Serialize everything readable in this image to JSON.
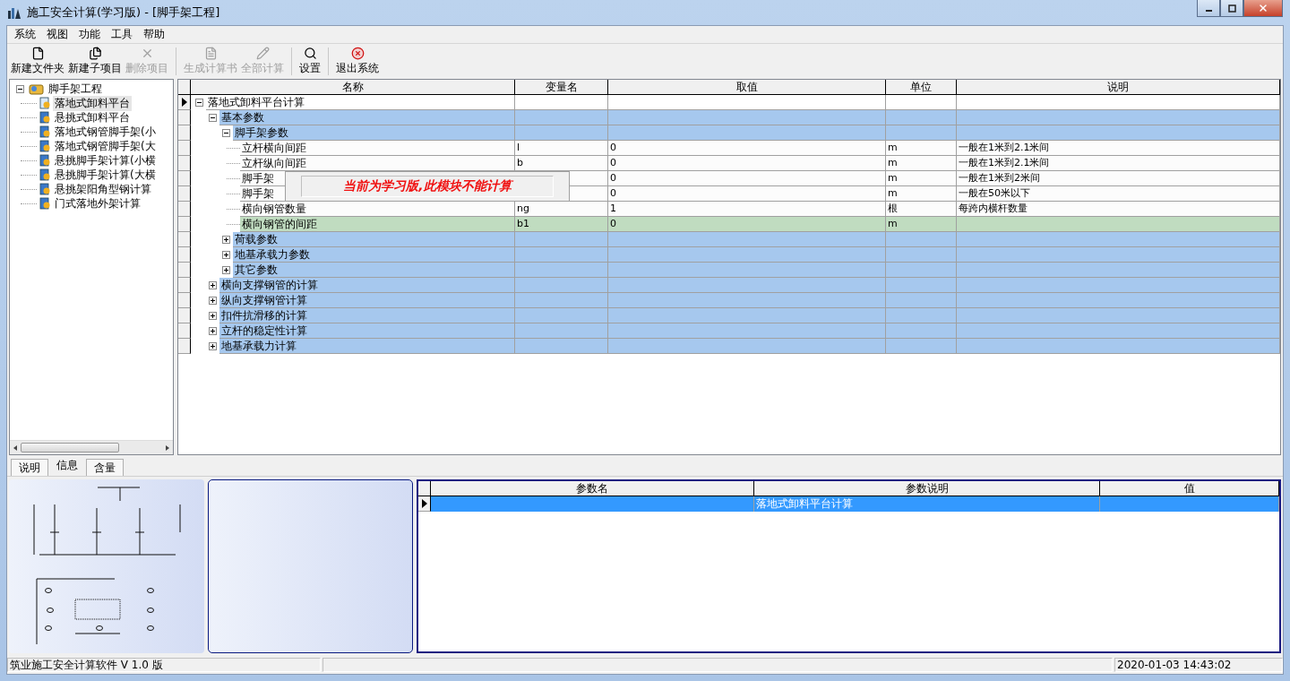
{
  "window": {
    "title": "施工安全计算(学习版) - [脚手架工程]"
  },
  "menu": [
    "系统",
    "视图",
    "功能",
    "工具",
    "帮助"
  ],
  "toolbar": [
    {
      "label": "新建文件夹",
      "disabled": false
    },
    {
      "label": "新建子项目",
      "disabled": false
    },
    {
      "label": "删除项目",
      "disabled": true
    },
    {
      "label": "生成计算书",
      "disabled": true
    },
    {
      "label": "全部计算",
      "disabled": true
    },
    {
      "label": "设置",
      "disabled": false
    },
    {
      "label": "退出系统",
      "disabled": false
    }
  ],
  "project_tree": {
    "label": "脚手架工程",
    "expanded": true,
    "children": [
      {
        "label": "落地式卸料平台",
        "selected": true
      },
      {
        "label": "悬挑式卸料平台",
        "selected": false
      },
      {
        "label": "落地式钢管脚手架(小",
        "selected": false
      },
      {
        "label": "落地式钢管脚手架(大",
        "selected": false
      },
      {
        "label": "悬挑脚手架计算(小横",
        "selected": false
      },
      {
        "label": "悬挑脚手架计算(大横",
        "selected": false
      },
      {
        "label": "悬挑架阳角型钢计算",
        "selected": false
      },
      {
        "label": "门式落地外架计算",
        "selected": false
      }
    ]
  },
  "grid": {
    "columns": [
      "名称",
      "变量名",
      "取值",
      "单位",
      "说明"
    ],
    "rows": [
      {
        "name": "落地式卸料平台计算",
        "kind": "calc",
        "expanded": true,
        "current": true,
        "selected": false,
        "children": [
          {
            "name": "基本参数",
            "kind": "group",
            "expanded": true,
            "current": false,
            "selected": false,
            "children": [
              {
                "name": "脚手架参数",
                "kind": "group",
                "expanded": true,
                "current": false,
                "selected": false,
                "children": [
                  {
                    "name": "立杆横向间距",
                    "kind": "param",
                    "variable": "l",
                    "value": "0",
                    "unit": "m",
                    "note": "一般在1米到2.1米间",
                    "current": false,
                    "selected": false
                  },
                  {
                    "name": "立杆纵向间距",
                    "kind": "param",
                    "variable": "b",
                    "value": "0",
                    "unit": "m",
                    "note": "一般在1米到2.1米间",
                    "current": false,
                    "selected": false
                  },
                  {
                    "name": "脚手架",
                    "kind": "param",
                    "value": "0",
                    "unit": "m",
                    "note": "一般在1米到2米间",
                    "current": false,
                    "selected": false
                  },
                  {
                    "name": "脚手架",
                    "kind": "param",
                    "value": "0",
                    "unit": "m",
                    "note": "一般在50米以下",
                    "current": false,
                    "selected": false
                  },
                  {
                    "name": "横向钢管数量",
                    "kind": "param",
                    "variable": "ng",
                    "value": "1",
                    "unit": "根",
                    "note": "每跨内横杆数量",
                    "current": false,
                    "selected": false
                  },
                  {
                    "name": "横向钢管的间距",
                    "kind": "param",
                    "variable": "b1",
                    "value": "0",
                    "unit": "m",
                    "current": false,
                    "selected": true
                  }
                ]
              },
              {
                "name": "荷载参数",
                "kind": "group",
                "expanded": false,
                "current": false,
                "selected": false
              },
              {
                "name": "地基承载力参数",
                "kind": "group",
                "expanded": false,
                "current": false,
                "selected": false
              },
              {
                "name": "其它参数",
                "kind": "group",
                "expanded": false,
                "current": false,
                "selected": false
              }
            ]
          },
          {
            "name": "横向支撑钢管的计算",
            "kind": "group",
            "expanded": false,
            "current": false,
            "selected": false
          },
          {
            "name": "纵向支撑钢管计算",
            "kind": "group",
            "expanded": false,
            "current": false,
            "selected": false
          },
          {
            "name": "扣件抗滑移的计算",
            "kind": "group",
            "expanded": false,
            "current": false,
            "selected": false
          },
          {
            "name": "立杆的稳定性计算",
            "kind": "group",
            "expanded": false,
            "current": false,
            "selected": false
          },
          {
            "name": "地基承载力计算",
            "kind": "group",
            "expanded": false,
            "current": false,
            "selected": false
          }
        ]
      }
    ]
  },
  "notice": "当前为学习版,此模块不能计算",
  "bottom_tabs": [
    {
      "label": "说明",
      "selected": false
    },
    {
      "label": "信息",
      "selected": true
    },
    {
      "label": "含量",
      "selected": false
    }
  ],
  "param_table": {
    "columns": [
      "参数名",
      "参数说明",
      "值"
    ],
    "rows": [
      {
        "cells": [
          "",
          "落地式卸料平台计算",
          ""
        ],
        "current": true,
        "selected": true
      }
    ]
  },
  "status_bar": [
    "筑业施工安全计算软件 V 1.0 版",
    "2020-01-03 14:43:02"
  ]
}
